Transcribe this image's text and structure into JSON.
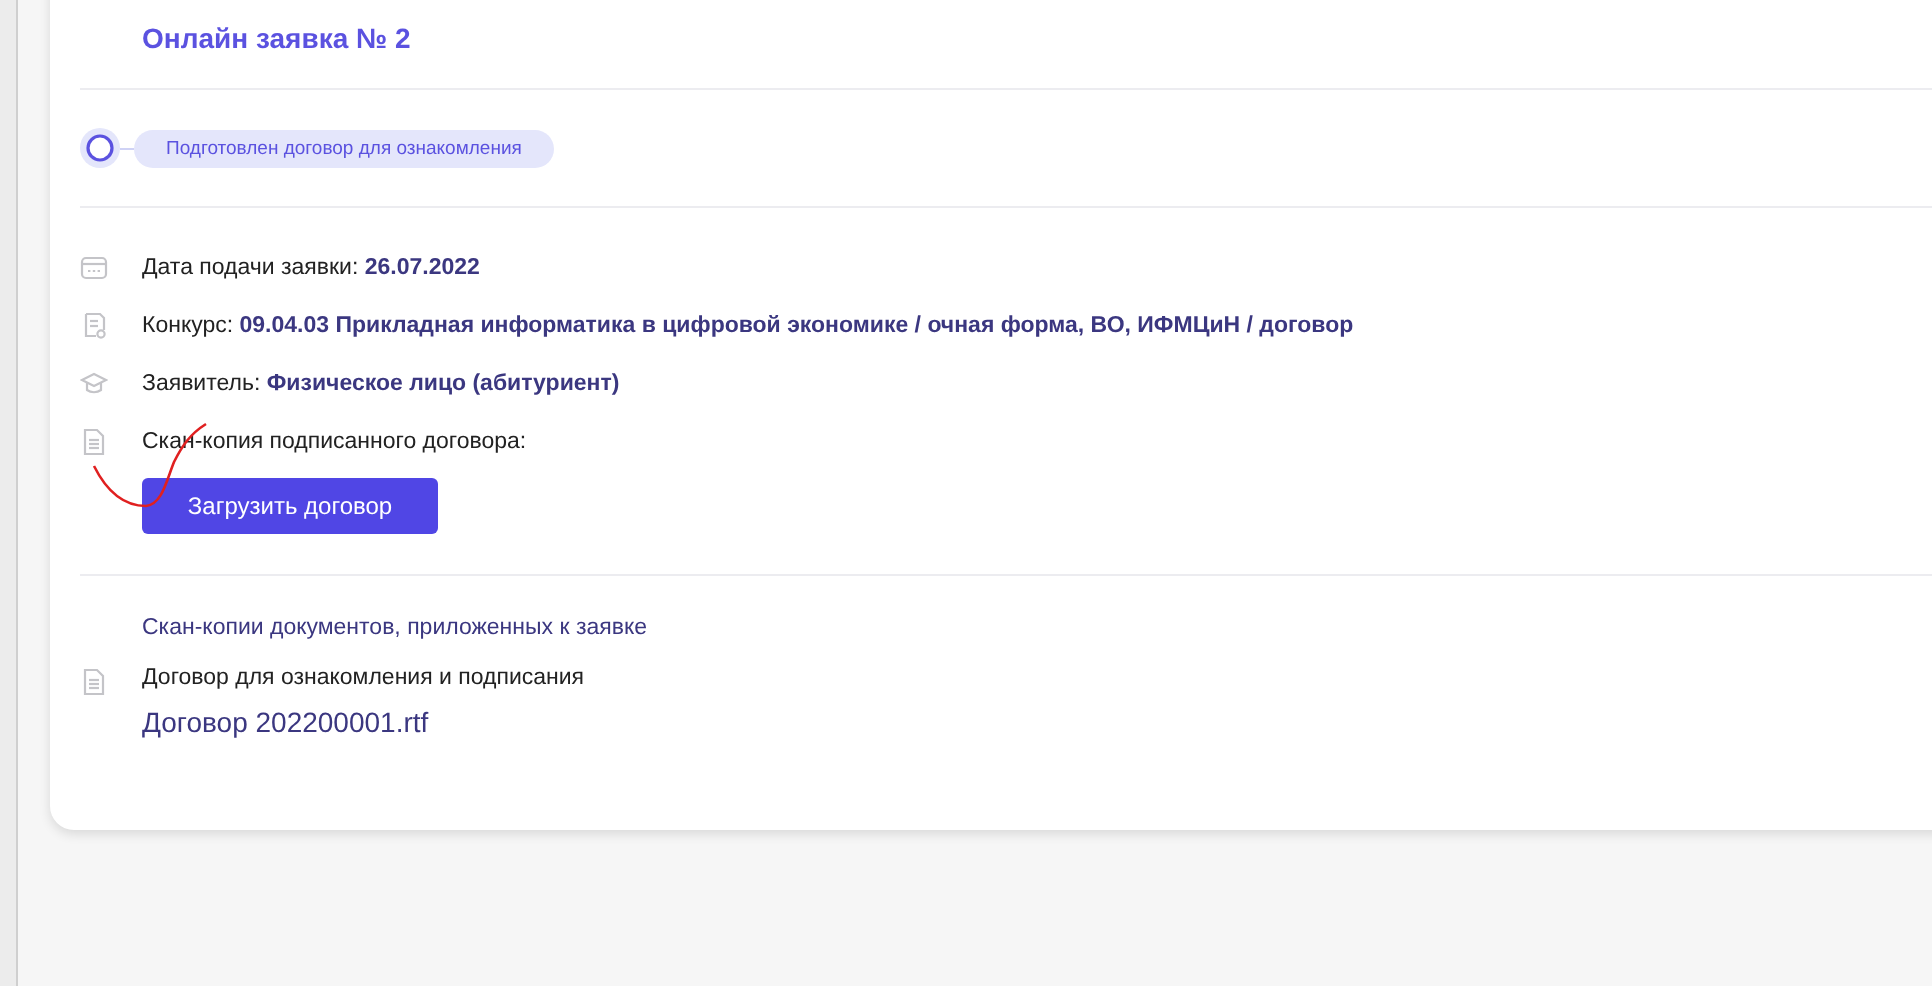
{
  "application": {
    "title": "Онлайн заявка № 2"
  },
  "status": {
    "label": "Подготовлен договор для ознакомления"
  },
  "details": [
    {
      "kind": "calendar",
      "label": "Дата подачи заявки:",
      "value": "26.07.2022"
    },
    {
      "kind": "certificate",
      "label": "Конкурс:",
      "value": "09.04.03 Прикладная информатика в цифровой экономике / очная форма, ВО, ИФМЦиН / договор"
    },
    {
      "kind": "cap",
      "label": "Заявитель:",
      "value": "Физическое лицо (абитуриент)"
    },
    {
      "kind": "document",
      "label": "Скан-копия подписанного договора:"
    }
  ],
  "upload_button": "Загрузить договор",
  "documents": {
    "title": "Скан-копии документов, приложенных к заявке",
    "items": [
      {
        "label": "Договор для ознакомления и подписания",
        "file": "Договор 202200001.rtf"
      }
    ]
  }
}
